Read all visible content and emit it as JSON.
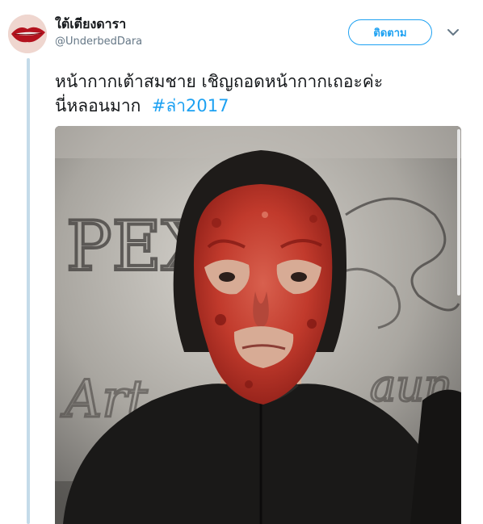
{
  "tweet": {
    "display_name": "ใต้เตียงดารา",
    "handle": "@UnderbedDara",
    "follow_label": "ติดตาม",
    "text_line1": "หน้ากากเต้าสมชาย เชิญถอดหน้ากากเถอะค่ะ",
    "text_line2": "นี่หลอนมาก",
    "hashtag": "#ล่า2017",
    "wall_graffiti_1": "PEX",
    "wall_graffiti_2": "Art",
    "wall_graffiti_3": "aun",
    "icons": {
      "avatar": "lips-avatar",
      "menu": "chevron-down-icon"
    },
    "colors": {
      "accent": "#1da1f2",
      "thread_line": "#c4dbe9",
      "text": "#14171a",
      "muted": "#657786"
    }
  }
}
